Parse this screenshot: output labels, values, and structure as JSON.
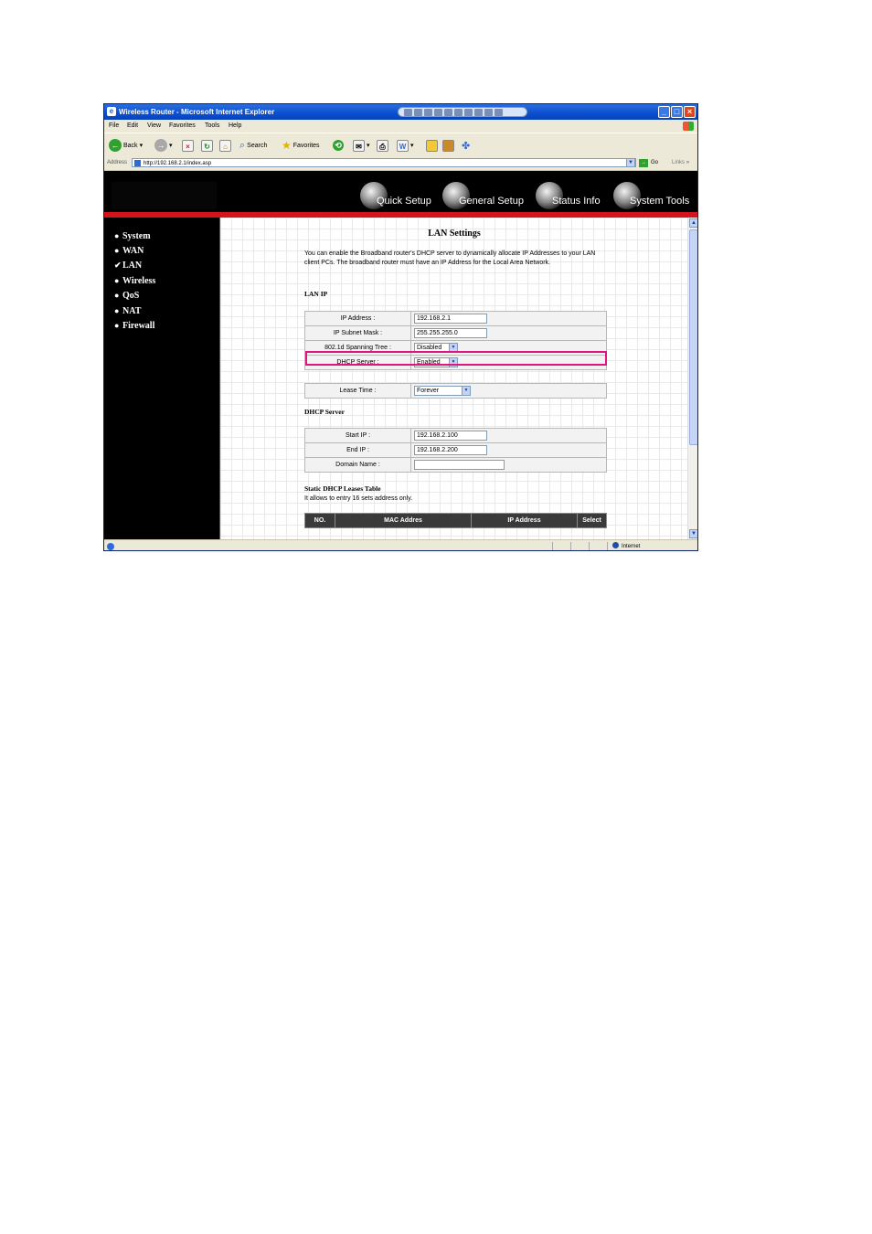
{
  "window": {
    "title": "Wireless Router - Microsoft Internet Explorer"
  },
  "menu": [
    "File",
    "Edit",
    "View",
    "Favorites",
    "Tools",
    "Help"
  ],
  "toolbar": {
    "back": "Back",
    "search": "Search",
    "favorites": "Favorites"
  },
  "address": {
    "label": "Address",
    "url": "http://192.168.2.1/index.asp",
    "go": "Go",
    "links": "Links"
  },
  "header_nav": [
    "Quick Setup",
    "General Setup",
    "Status Info",
    "System Tools"
  ],
  "sidebar": [
    {
      "label": "System",
      "bullet": "●"
    },
    {
      "label": "WAN",
      "bullet": "●"
    },
    {
      "label": "LAN",
      "bullet": "✔"
    },
    {
      "label": "Wireless",
      "bullet": "●"
    },
    {
      "label": "QoS",
      "bullet": "●"
    },
    {
      "label": "NAT",
      "bullet": "●"
    },
    {
      "label": "Firewall",
      "bullet": "●"
    }
  ],
  "content": {
    "title": "LAN Settings",
    "description": "You can enable the Broadband router's DHCP server to dynamically allocate IP Addresses to your LAN client PCs. The broadband router must have an IP Address for the Local Area Network.",
    "lan_ip_heading": "LAN IP",
    "lan_ip": {
      "ip_address_label": "IP Address :",
      "ip_address": "192.168.2.1",
      "subnet_label": "IP Subnet Mask :",
      "subnet": "255.255.255.0",
      "spanning_label": "802.1d Spanning Tree :",
      "spanning": "Disabled",
      "dhcp_label": "DHCP Server :",
      "dhcp": "Enabled"
    },
    "lease_label": "Lease Time :",
    "lease": "Forever",
    "dhcp_heading": "DHCP Server",
    "dhcp": {
      "start_label": "Start IP :",
      "start": "192.168.2.100",
      "end_label": "End IP :",
      "end": "192.168.2.200",
      "domain_label": "Domain Name :",
      "domain": ""
    },
    "static_heading": "Static DHCP Leases Table",
    "static_note": "It allows to entry 16 sets address only.",
    "static_columns": [
      "NO.",
      "MAC Addres",
      "IP Address",
      "Select"
    ]
  },
  "status": {
    "zone": "Internet"
  },
  "colors": {
    "highlight": "#e0157d",
    "header_red": "#d3141c"
  }
}
